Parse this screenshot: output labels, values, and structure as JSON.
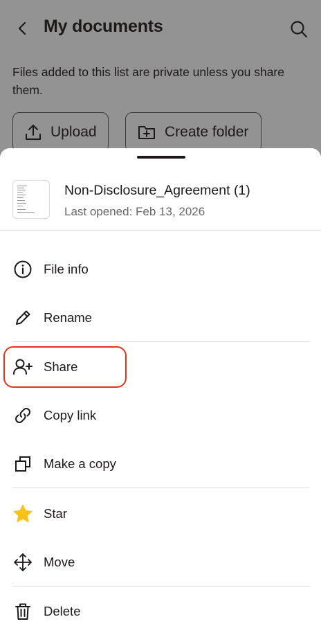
{
  "header": {
    "title": "My documents"
  },
  "info": {
    "text": "Files added to this list are private unless you share them."
  },
  "actions": {
    "upload": "Upload",
    "create_folder": "Create folder"
  },
  "file": {
    "name": "Non-Disclosure_Agreement (1)",
    "meta": "Last opened: Feb 13, 2026"
  },
  "menu": {
    "file_info": "File info",
    "rename": "Rename",
    "share": "Share",
    "copy_link": "Copy link",
    "make_copy": "Make a copy",
    "star": "Star",
    "move": "Move",
    "delete": "Delete"
  },
  "colors": {
    "highlight": "#e8311b",
    "star": "#f7c21b"
  }
}
